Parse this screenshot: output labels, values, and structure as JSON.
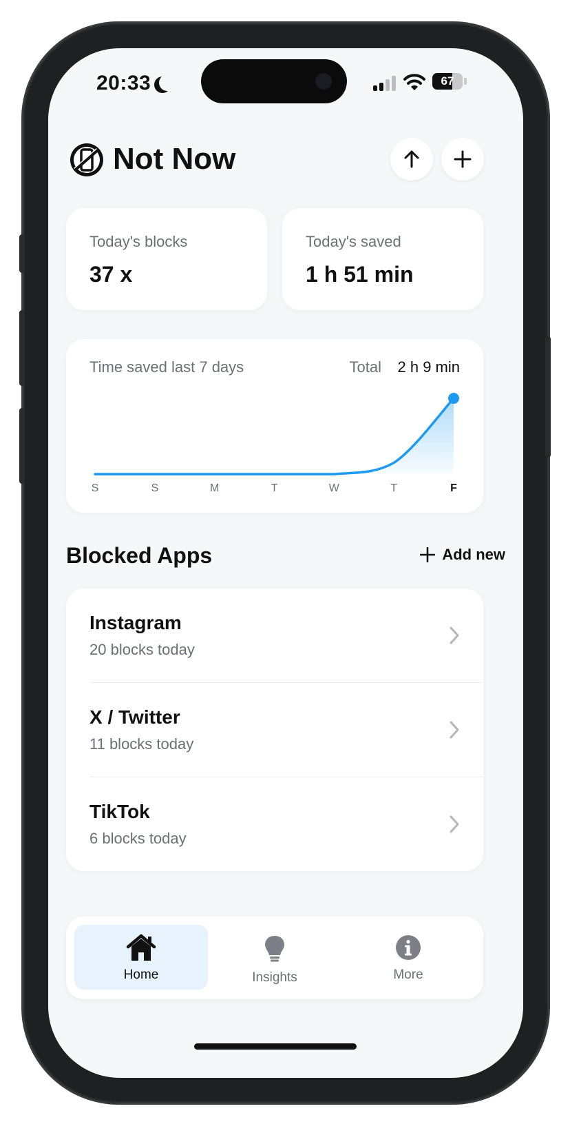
{
  "status": {
    "time": "20:33",
    "battery": "67",
    "battery_level": 0.67
  },
  "header": {
    "title": "Not Now"
  },
  "stats": {
    "blocks_label": "Today's blocks",
    "blocks_value": "37 x",
    "saved_label": "Today's saved",
    "saved_value": "1 h 51 min"
  },
  "chart_card": {
    "title": "Time saved last 7 days",
    "total_label": "Total",
    "total_value": "2 h 9 min"
  },
  "chart_data": {
    "type": "area",
    "categories": [
      "S",
      "S",
      "M",
      "T",
      "W",
      "T",
      "F"
    ],
    "values": [
      0,
      0,
      0,
      0,
      0,
      0.15,
      1
    ],
    "highlighted_category_index": 6,
    "ylim": [
      0,
      1
    ],
    "grid": false,
    "line_color": "#1e9bf0"
  },
  "blocked": {
    "title": "Blocked Apps",
    "add_label": "Add new",
    "apps": [
      {
        "name": "Instagram",
        "sub": "20 blocks today"
      },
      {
        "name": "X / Twitter",
        "sub": "11 blocks today"
      },
      {
        "name": "TikTok",
        "sub": "6 blocks today"
      }
    ]
  },
  "tabs": [
    {
      "label": "Home",
      "icon": "home-icon",
      "active": true
    },
    {
      "label": "Insights",
      "icon": "lightbulb-icon",
      "active": false
    },
    {
      "label": "More",
      "icon": "info-icon",
      "active": false
    }
  ],
  "colors": {
    "accent": "#1e9bf0",
    "tab_active_bg": "#e7f2fc"
  }
}
